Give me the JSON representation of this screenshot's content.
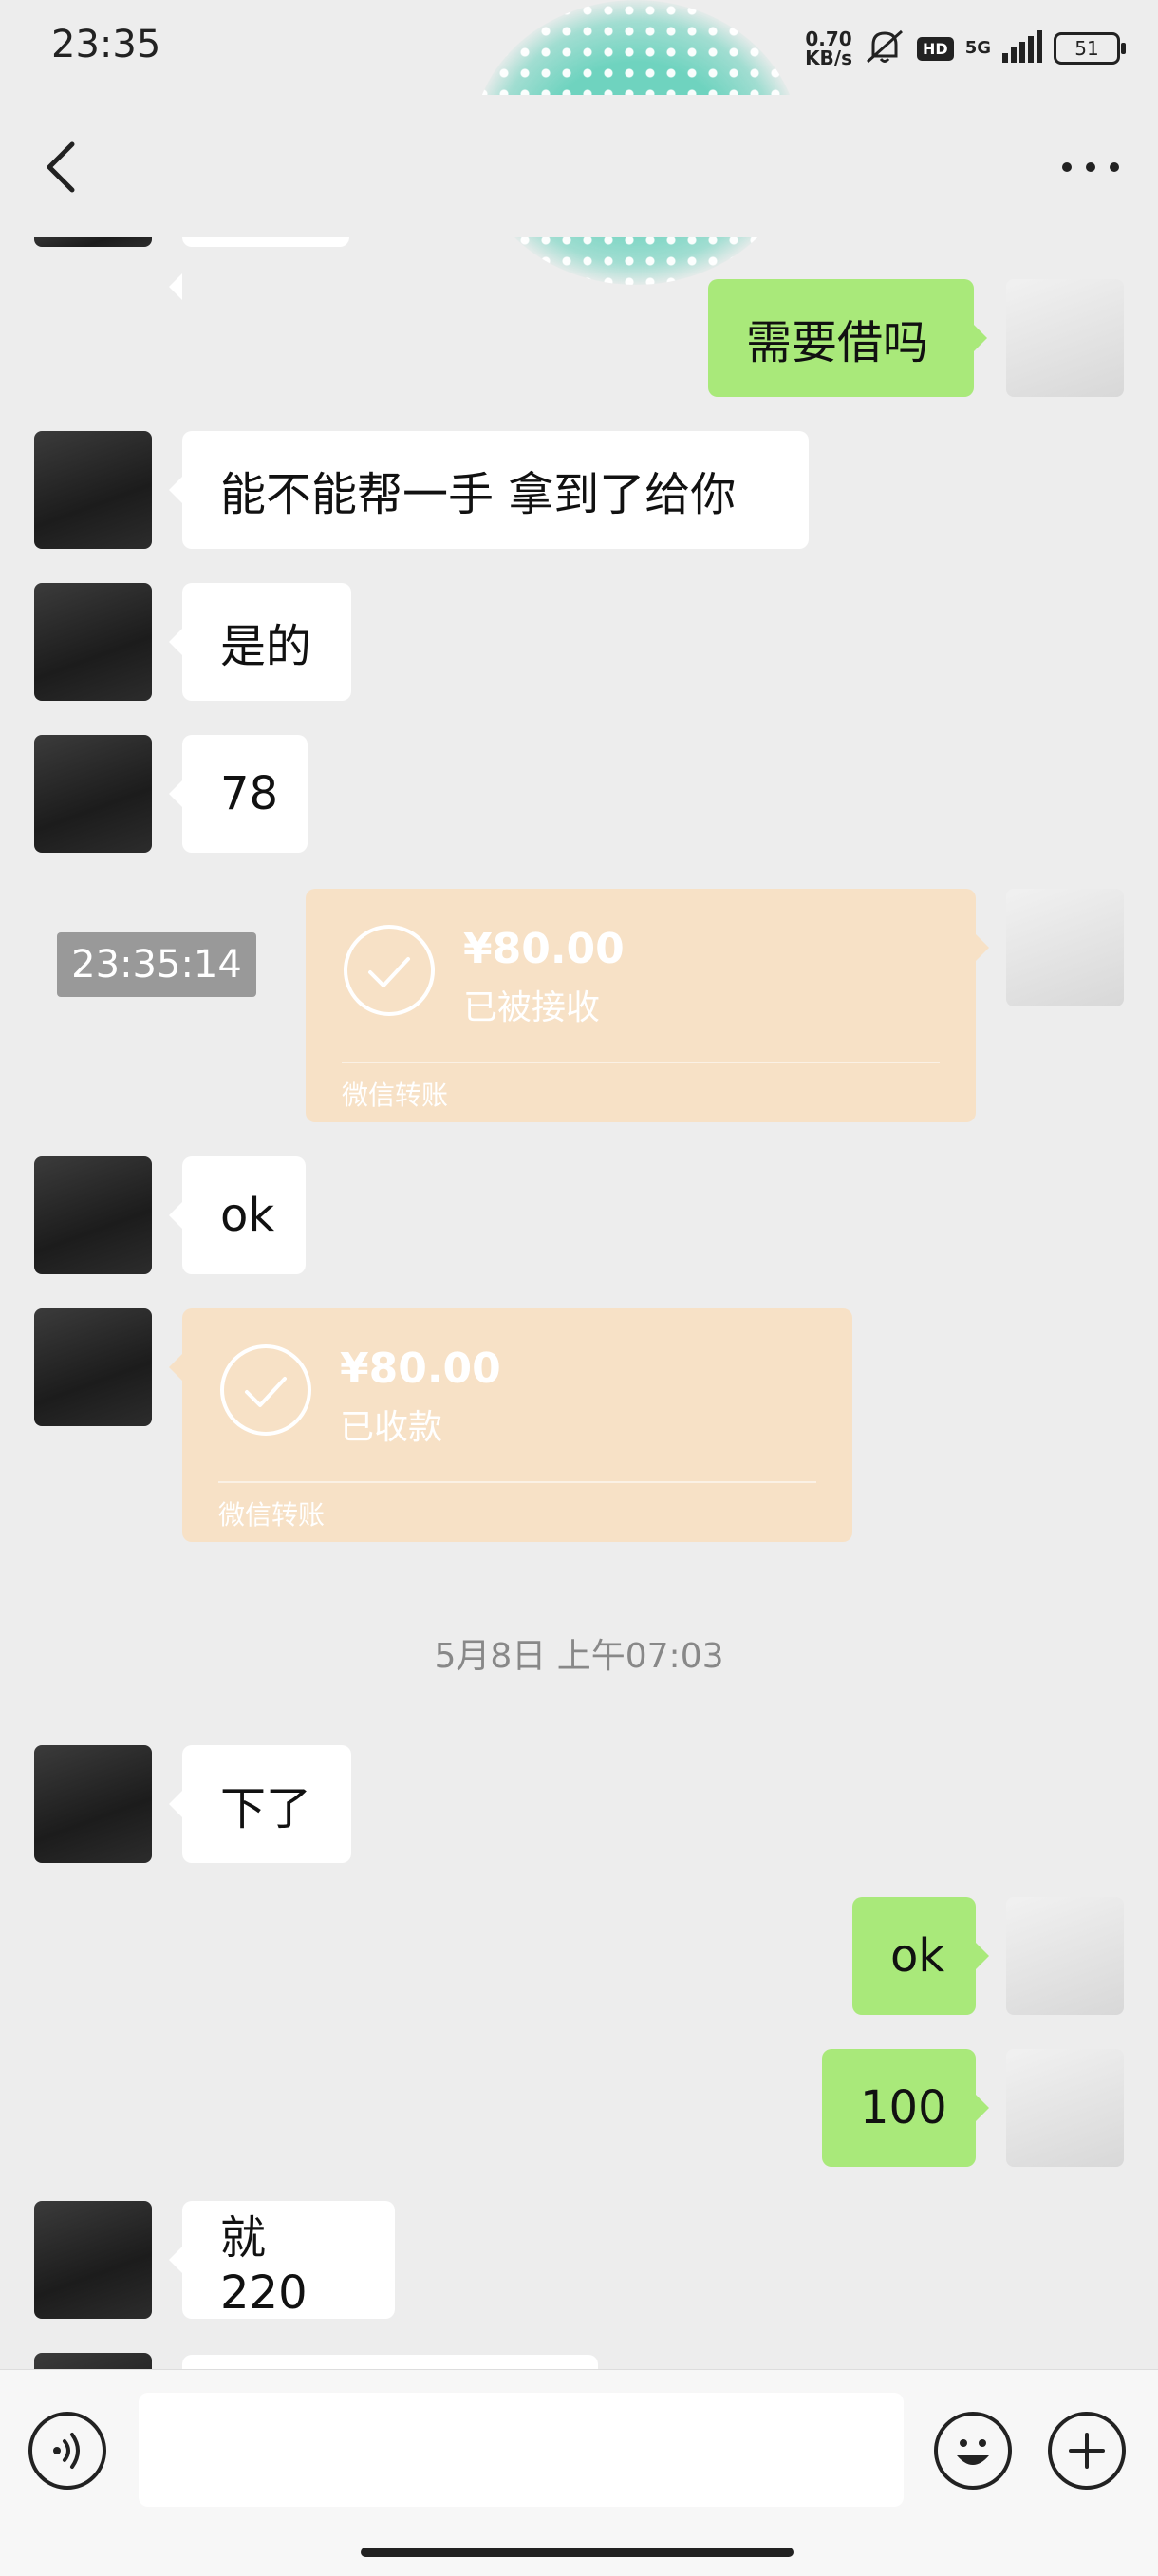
{
  "status_bar": {
    "time": "23:35",
    "net_speed_value": "0.70",
    "net_speed_unit": "KB/s",
    "hd": "HD",
    "network": "5G",
    "battery": "51"
  },
  "top_bar": {
    "back_icon": "chevron-left-icon",
    "more_icon": "more-dots-icon"
  },
  "messages": [
    {
      "side": "me",
      "text": "需要借吗"
    },
    {
      "side": "other",
      "text": "能不能帮一手 拿到了给你"
    },
    {
      "side": "other",
      "text": "是的"
    },
    {
      "side": "other",
      "text": "78"
    },
    {
      "side": "me",
      "type": "transfer",
      "amount": "¥80.00",
      "status": "已被接收",
      "label": "微信转账"
    },
    {
      "side": "other",
      "text": "ok"
    },
    {
      "side": "other",
      "type": "transfer",
      "amount": "¥80.00",
      "status": "已收款",
      "label": "微信转账"
    },
    {
      "side": "other",
      "text": "下了"
    },
    {
      "side": "me",
      "text": "ok"
    },
    {
      "side": "me",
      "text": "100"
    },
    {
      "side": "other",
      "text": "就 220"
    }
  ],
  "time_tooltip": "23:35:14",
  "date_separator": "5月8日 上午07:03",
  "input_bar": {
    "voice_icon": "voice-icon",
    "emoji_icon": "emoji-icon",
    "plus_icon": "plus-icon",
    "input_value": ""
  },
  "colors": {
    "me_bubble": "#a9e97a",
    "other_bubble": "#ffffff",
    "transfer": "#f7e1c6",
    "background": "#ededed"
  }
}
